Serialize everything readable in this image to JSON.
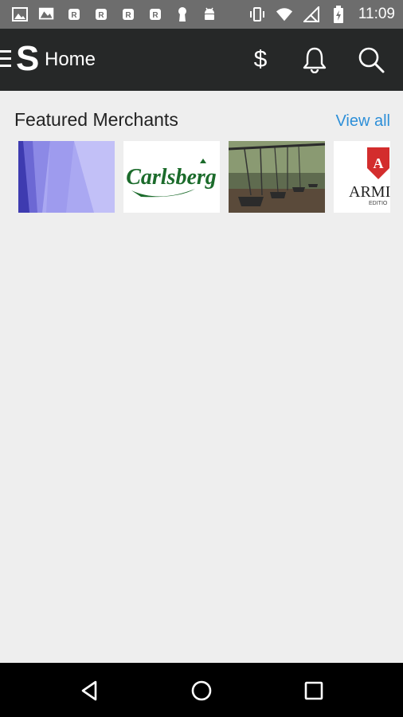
{
  "status_bar": {
    "time": "11:09",
    "left_icons": [
      "gallery-icon",
      "photos-icon",
      "r-badge-icon",
      "r-badge-icon",
      "r-badge-icon",
      "r-badge-icon",
      "keyhole-icon",
      "android-icon"
    ],
    "right_icons": [
      "vibrate-icon",
      "wifi-icon",
      "no-signal-icon",
      "battery-charging-icon"
    ]
  },
  "app_bar": {
    "logo": "S",
    "title": "Home",
    "actions": [
      "dollar-icon",
      "bell-icon",
      "search-icon"
    ],
    "dollar_symbol": "$"
  },
  "featured": {
    "title": "Featured Merchants",
    "view_all": "View all",
    "merchants": [
      {
        "name": "merchant-abstract"
      },
      {
        "name": "merchant-carlsberg",
        "logo_text": "Carlsberg"
      },
      {
        "name": "merchant-swings"
      },
      {
        "name": "merchant-armi",
        "logo_text": "ARMI",
        "sub_text": "EDITIO"
      }
    ]
  },
  "colors": {
    "app_bar": "#262828",
    "status_bar": "#6d6d6d",
    "background": "#eeeeee",
    "accent": "#2d8fd8",
    "carlsberg_green": "#1b6b2b",
    "armi_red": "#d32d2d"
  },
  "nav_bar": {
    "buttons": [
      "back-icon",
      "home-icon",
      "recents-icon"
    ]
  }
}
